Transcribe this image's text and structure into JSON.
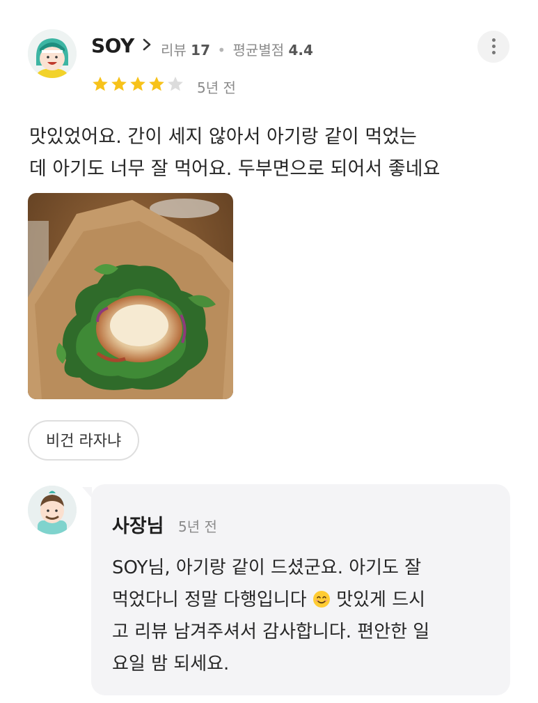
{
  "review": {
    "username": "SOY",
    "review_count_label": "리뷰",
    "review_count": "17",
    "avg_rating_label": "평균별점",
    "avg_rating": "4.4",
    "rating": 4,
    "max_rating": 5,
    "age": "5년 전",
    "text_line1": "맛있었어요. 간이 세지 않아서 아기랑 같이 먹었는",
    "text_line2": "데 아기도 너무 잘 먹어요. 두부면으로 되어서 좋네요",
    "menu_tag": "비건 라자냐",
    "icons": {
      "more": "more-vertical-icon",
      "chevron": "chevron-right-icon",
      "star": "star-icon"
    }
  },
  "reply": {
    "author": "사장님",
    "age": "5년 전",
    "text_line1": "SOY님, 아기랑 같이 드셨군요. 아기도 잘",
    "text_line2a": "먹었다니 정말 다행입니다",
    "text_line2b": "맛있게 드시",
    "text_line3": "고 리뷰 남겨주셔서 감사합니다. 편안한 일",
    "text_line4": "요일 밤 되세요.",
    "emoji": "smiling-face-icon"
  },
  "colors": {
    "star_filled": "#f7c21a",
    "star_empty": "#dcdcdc",
    "reply_bg": "#f4f4f6"
  }
}
